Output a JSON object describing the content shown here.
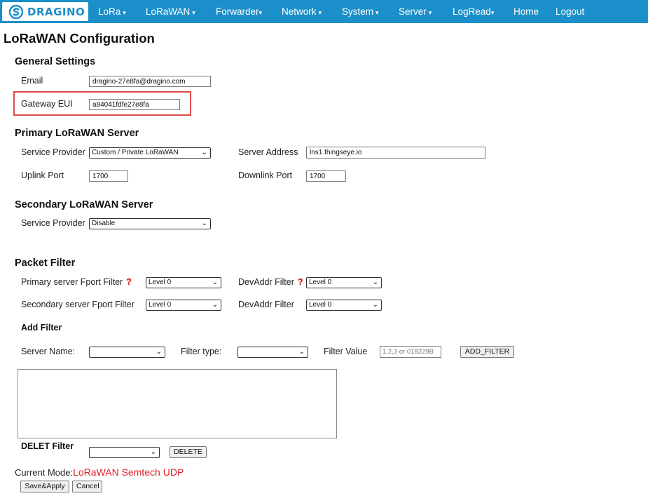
{
  "nav": {
    "brand": "DRAGINO",
    "items": [
      {
        "label": "LoRa",
        "dropdown": true
      },
      {
        "label": "LoRaWAN",
        "dropdown": true
      },
      {
        "label": "Forwarder",
        "dropdown": true
      },
      {
        "label": "Network",
        "dropdown": true
      },
      {
        "label": "System",
        "dropdown": true
      },
      {
        "label": "Server",
        "dropdown": true
      },
      {
        "label": "LogRead",
        "dropdown": true
      },
      {
        "label": "Home",
        "dropdown": false
      },
      {
        "label": "Logout",
        "dropdown": false
      }
    ],
    "caret": "▾",
    "bar_color": "#1b8fc9"
  },
  "page": {
    "title": "LoRaWAN Configuration"
  },
  "general": {
    "heading": "General Settings",
    "email_label": "Email",
    "email_value": "dragino-27e8fa@dragino.com",
    "eui_label": "Gateway EUI",
    "eui_value": "a84041fdfe27e8fa",
    "highlight_color": "#e04a4a"
  },
  "primary": {
    "heading": "Primary LoRaWAN Server",
    "provider_label": "Service Provider",
    "provider_value": "Custom / Private LoRaWAN",
    "address_label": "Server Address",
    "address_value": "lns1.thingseye.io",
    "uplink_label": "Uplink Port",
    "uplink_value": "1700",
    "downlink_label": "Downlink Port",
    "downlink_value": "1700"
  },
  "secondary": {
    "heading": "Secondary LoRaWAN Server",
    "provider_label": "Service Provider",
    "provider_value": "Disable"
  },
  "packet_filter": {
    "heading": "Packet Filter",
    "primary_fport_label": "Primary server Fport Filter",
    "primary_fport_value": "Level 0",
    "primary_devaddr_label": "DevAddr Filter",
    "primary_devaddr_value": "Level 0",
    "secondary_fport_label": "Secondary server Fport Filter",
    "secondary_fport_value": "Level 0",
    "secondary_devaddr_label": "DevAddr Filter",
    "secondary_devaddr_value": "Level 0",
    "help_mark": "?",
    "add_heading": "Add Filter",
    "server_name_label": "Server Name:",
    "server_name_value": "",
    "filter_type_label": "Filter type:",
    "filter_type_value": "",
    "filter_value_label": "Filter Value",
    "filter_value_placeholder": "1,2,3 or 018229B",
    "add_button": "ADD_FILTER",
    "delete_heading": "DELET Filter",
    "delete_select_value": "",
    "delete_button": "DELETE"
  },
  "footer": {
    "mode_label": "Current Mode:",
    "mode_value": "LoRaWAN Semtech UDP",
    "mode_color": "#e02020",
    "save_button": "Save&Apply",
    "cancel_button": "Cancel"
  }
}
